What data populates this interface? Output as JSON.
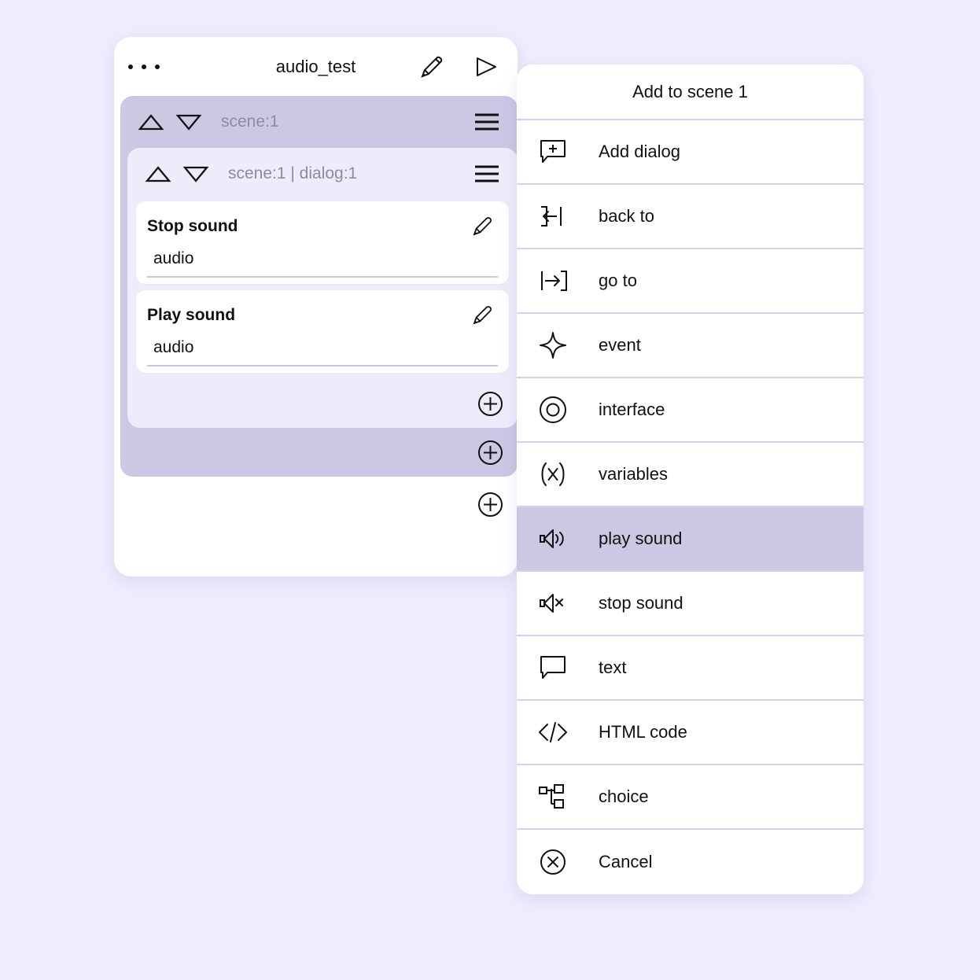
{
  "background_color": "#eeecfd",
  "accent_purple": "#cbc8e4",
  "divider_color": "#d4d1ea",
  "editor": {
    "title": "audio_test",
    "titlebar": {
      "menu_dots_icon": "more-dots-icon",
      "edit_icon": "pencil-icon",
      "run_icon": "play-triangle-icon"
    },
    "scene_row": {
      "label": "scene:1",
      "up_icon": "triangle-up-icon",
      "down_icon": "triangle-down-icon",
      "menu_icon": "hamburger-icon"
    },
    "dialog_row": {
      "label": "scene:1 | dialog:1",
      "up_icon": "triangle-up-icon",
      "down_icon": "triangle-down-icon",
      "menu_icon": "hamburger-icon"
    },
    "cards": [
      {
        "title": "Stop sound",
        "edit_icon": "pencil-icon",
        "field_value": "audio"
      },
      {
        "title": "Play sound",
        "edit_icon": "pencil-icon",
        "field_value": "audio"
      }
    ],
    "add_buttons": [
      {
        "icon": "plus-circle-icon",
        "scope": "dialog"
      },
      {
        "icon": "plus-circle-icon",
        "scope": "scene"
      },
      {
        "icon": "plus-circle-icon",
        "scope": "root"
      }
    ]
  },
  "menu": {
    "header": "Add to scene 1",
    "items": [
      {
        "label": "Add dialog",
        "icon": "speech-bubble-plus-icon",
        "selected": false
      },
      {
        "label": "back to",
        "icon": "back-to-icon",
        "selected": false
      },
      {
        "label": "go to",
        "icon": "go-to-icon",
        "selected": false
      },
      {
        "label": "event",
        "icon": "sparkle-icon",
        "selected": false
      },
      {
        "label": "interface",
        "icon": "circle-target-icon",
        "selected": false
      },
      {
        "label": "variables",
        "icon": "variable-x-icon",
        "selected": false
      },
      {
        "label": "play sound",
        "icon": "speaker-play-icon",
        "selected": true
      },
      {
        "label": "stop sound",
        "icon": "speaker-mute-icon",
        "selected": false
      },
      {
        "label": "text",
        "icon": "speech-bubble-icon",
        "selected": false
      },
      {
        "label": "HTML code",
        "icon": "code-brackets-icon",
        "selected": false
      },
      {
        "label": "choice",
        "icon": "branch-nodes-icon",
        "selected": false
      },
      {
        "label": "Cancel",
        "icon": "circle-x-icon",
        "selected": false
      }
    ]
  }
}
